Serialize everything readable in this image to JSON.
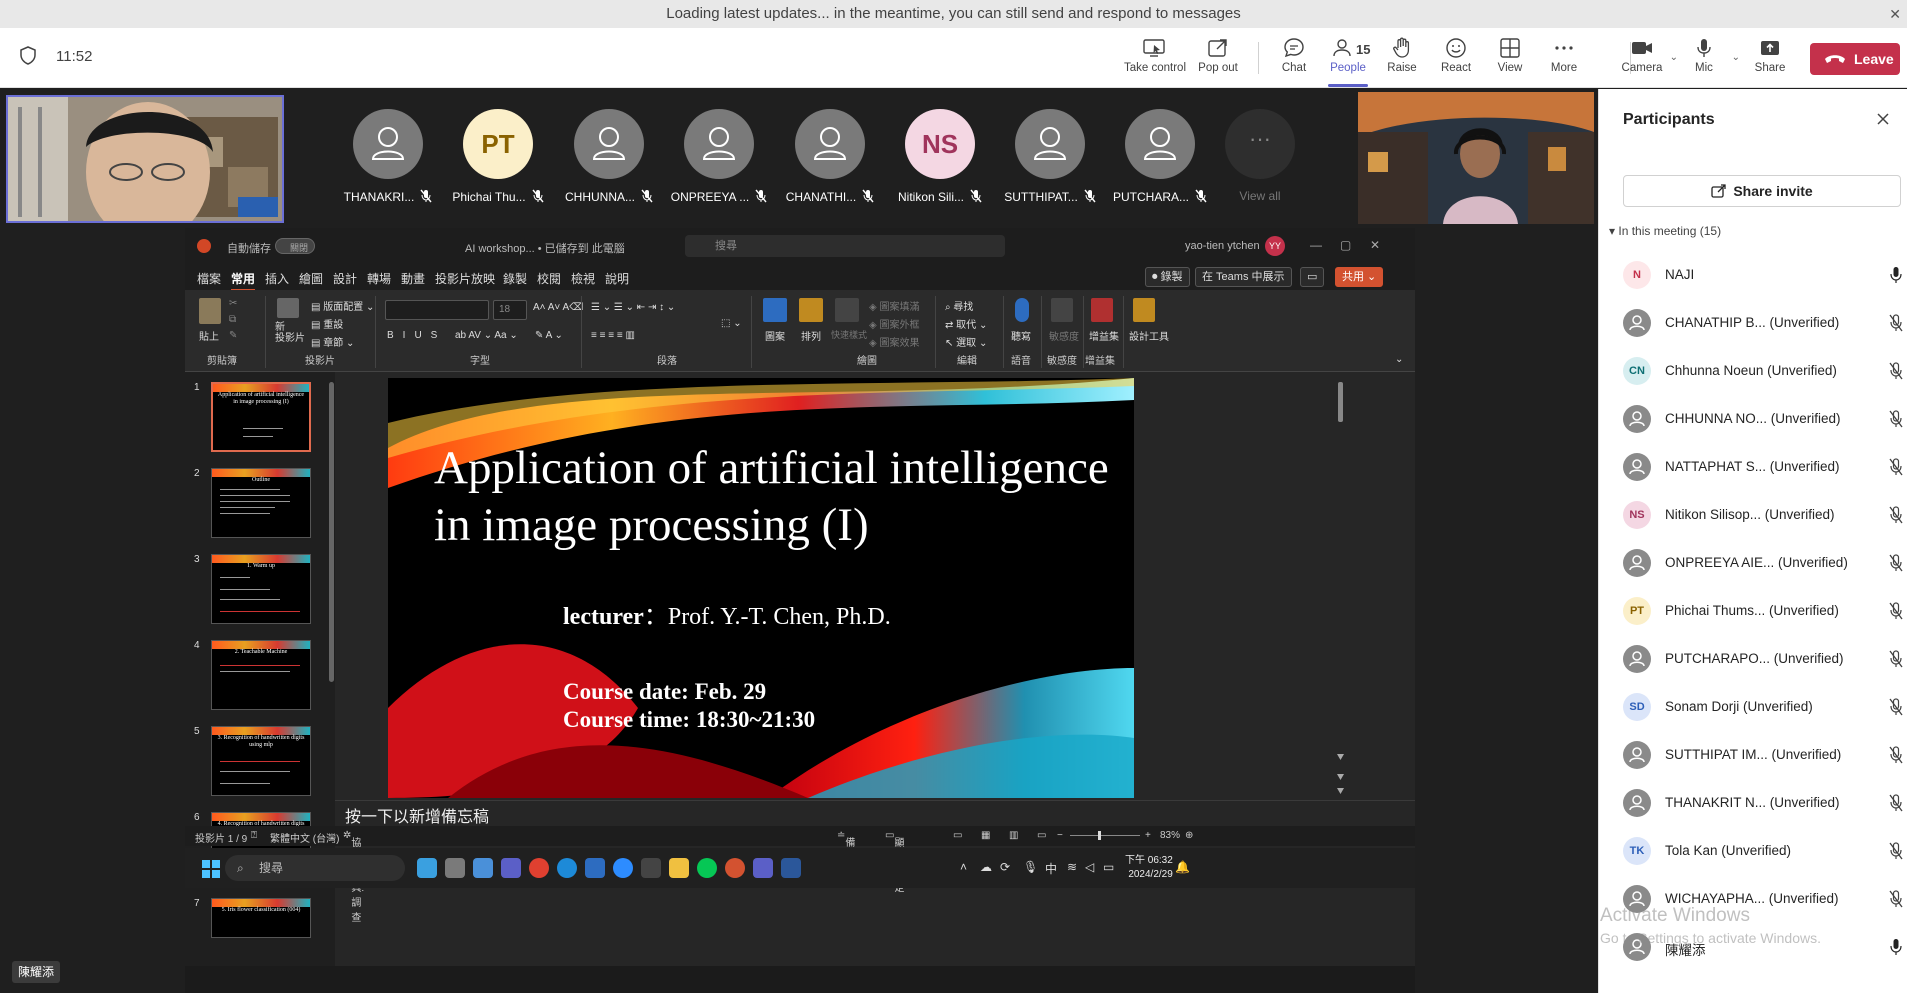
{
  "banner": {
    "text": "Loading latest updates... in the meantime, you can still send and respond to messages"
  },
  "topbar": {
    "time": "11:52",
    "buttons": {
      "take_control": "Take control",
      "pop_out": "Pop out",
      "chat": "Chat",
      "people": "People",
      "people_count": "15",
      "raise": "Raise",
      "react": "React",
      "view": "View",
      "more": "More",
      "camera": "Camera",
      "mic": "Mic",
      "share": "Share",
      "leave": "Leave"
    }
  },
  "stage": {
    "participants": [
      {
        "name": "THANAKRI...",
        "initials": ""
      },
      {
        "name": "Phichai Thu...",
        "initials": "PT"
      },
      {
        "name": "CHHUNNA...",
        "initials": ""
      },
      {
        "name": "ONPREEYA ...",
        "initials": ""
      },
      {
        "name": "CHANATHI...",
        "initials": ""
      },
      {
        "name": "Nitikon Sili...",
        "initials": "NS"
      },
      {
        "name": "SUTTHIPAT...",
        "initials": ""
      },
      {
        "name": "PUTCHARA...",
        "initials": ""
      }
    ],
    "view_all": "View all",
    "view_all_dots": "···",
    "bottom_name": "陳耀添"
  },
  "ppt": {
    "autosave": "自動儲存",
    "toggle_state": "關閉",
    "doc_name": "AI workshop... • 已儲存到 此電腦",
    "search_placeholder": "搜尋",
    "user": "yao-tien ytchen",
    "user_initials": "YY",
    "menu": [
      "檔案",
      "常用",
      "插入",
      "繪圖",
      "設計",
      "轉場",
      "動畫",
      "投影片放映",
      "錄製",
      "校閱",
      "檢視",
      "說明"
    ],
    "record_btn": "錄製",
    "teams_btn": "在 Teams 中展示",
    "share_btn": "共用",
    "ribbon_groups": {
      "clipboard": "剪貼簿",
      "slides": "投影片",
      "font": "字型",
      "paragraph": "段落",
      "drawing": "繪圖",
      "editing": "編輯",
      "voice": "語音",
      "sensitivity": "敏感度",
      "addins": "增益集"
    },
    "ribbon_labels": {
      "paste": "貼上",
      "new_slide": "新\n投影片",
      "layout": "版面配置",
      "reset": "重設",
      "section": "章節",
      "font_size": "18",
      "shapes": "圖案",
      "arrange": "排列",
      "quick_styles": "快速樣式",
      "shape_fill": "圖案填滿",
      "shape_outline": "圖案外框",
      "shape_effects": "圖案效果",
      "find": "尋找",
      "replace": "取代",
      "select": "選取",
      "dictate": "聽寫",
      "sensitivity": "敏感度",
      "addins": "增益集",
      "designer": "設計工具"
    },
    "thumbnails": [
      {
        "num": "1",
        "title": "Application of artificial intelligence in image processing (I)"
      },
      {
        "num": "2",
        "title": "Outline"
      },
      {
        "num": "3",
        "title": "1. Warm up"
      },
      {
        "num": "4",
        "title": "2. Teachable Machine"
      },
      {
        "num": "5",
        "title": "3. Recognition of handwritten digits using mlp"
      },
      {
        "num": "6",
        "title": "4. Recognition of handwritten digits using CNN"
      },
      {
        "num": "7",
        "title": "5. Iris flower classification (004)"
      }
    ],
    "slide": {
      "title": "Application of artificial intelligence in image processing (I)",
      "lecturer_label": "lecturer",
      "lecturer_value": "：Prof. Y.-T. Chen, Ph.D.",
      "course_date": "Course date: Feb. 29",
      "course_time": "Course time: 18:30~21:30"
    },
    "notes_placeholder": "按一下以新增備忘稿",
    "status": {
      "slide_index": "投影片 1 / 9",
      "language": "繁體中文 (台灣)",
      "accessibility": "協助工具: 調查",
      "notes": "備忘稿",
      "display": "顯示設定",
      "zoom": "83%"
    },
    "taskbar": {
      "search": "搜尋",
      "time": "下午 06:32",
      "date": "2024/2/29",
      "ime": "中"
    }
  },
  "panel": {
    "title": "Participants",
    "share_invite": "Share invite",
    "in_meeting": "In this meeting (15)",
    "people": [
      {
        "initials": "N",
        "name": "NAJI",
        "style": "n",
        "mic": "on"
      },
      {
        "initials": "",
        "name": "CHANATHIP B...  (Unverified)",
        "style": "",
        "mic": "off"
      },
      {
        "initials": "CN",
        "name": "Chhunna Noeun (Unverified)",
        "style": "cn",
        "mic": "off"
      },
      {
        "initials": "",
        "name": "CHHUNNA NO...  (Unverified)",
        "style": "",
        "mic": "off"
      },
      {
        "initials": "",
        "name": "NATTAPHAT S...  (Unverified)",
        "style": "",
        "mic": "off"
      },
      {
        "initials": "NS",
        "name": "Nitikon Silisop...  (Unverified)",
        "style": "ns",
        "mic": "off"
      },
      {
        "initials": "",
        "name": "ONPREEYA AIE...  (Unverified)",
        "style": "",
        "mic": "off"
      },
      {
        "initials": "PT",
        "name": "Phichai Thums...  (Unverified)",
        "style": "pt",
        "mic": "off"
      },
      {
        "initials": "",
        "name": "PUTCHARAPO...  (Unverified)",
        "style": "",
        "mic": "off"
      },
      {
        "initials": "SD",
        "name": "Sonam Dorji (Unverified)",
        "style": "sd",
        "mic": "off"
      },
      {
        "initials": "",
        "name": "SUTTHIPAT IM...  (Unverified)",
        "style": "",
        "mic": "off"
      },
      {
        "initials": "",
        "name": "THANAKRIT N...  (Unverified)",
        "style": "",
        "mic": "off"
      },
      {
        "initials": "TK",
        "name": "Tola Kan (Unverified)",
        "style": "tk",
        "mic": "off"
      },
      {
        "initials": "",
        "name": "WICHAYAPHA...  (Unverified)",
        "style": "",
        "mic": "off"
      },
      {
        "initials": "",
        "name": "陳耀添",
        "style": "",
        "mic": "on"
      }
    ],
    "watermark_1": "Activate Windows",
    "watermark_2": "Go to Settings to activate Windows."
  },
  "colors": {
    "accent": "#5b5fc7",
    "leave": "#c4314b",
    "ppt": "#d35230"
  },
  "icons": [
    "shield-icon",
    "take-control-icon",
    "pop-out-icon",
    "chat-icon",
    "people-icon",
    "raise-hand-icon",
    "react-icon",
    "view-icon",
    "more-icon",
    "camera-icon",
    "mic-icon",
    "share-icon",
    "phone-hangup-icon",
    "close-icon",
    "mic-off-icon",
    "person-icon"
  ]
}
